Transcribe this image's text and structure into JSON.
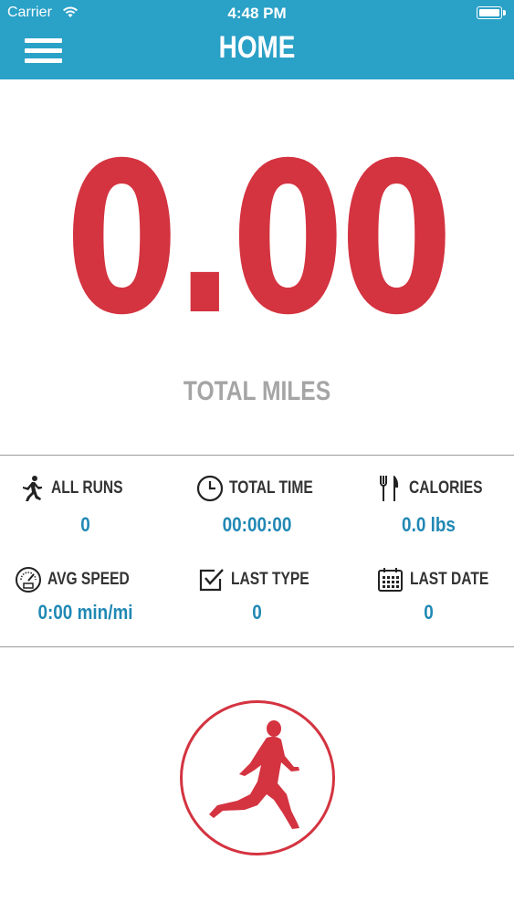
{
  "status_bar": {
    "carrier": "Carrier",
    "time": "4:48 PM"
  },
  "nav": {
    "title": "HOME"
  },
  "summary": {
    "total_value": "0.00",
    "total_label": "TOTAL MILES"
  },
  "stats": [
    {
      "icon": "runner-icon",
      "label": "ALL RUNS",
      "value": "0"
    },
    {
      "icon": "clock-icon",
      "label": "TOTAL TIME",
      "value": "00:00:00"
    },
    {
      "icon": "fork-knife-icon",
      "label": "CALORIES",
      "value": "0.0 lbs"
    },
    {
      "icon": "speedometer-icon",
      "label": "AVG SPEED",
      "value": "0:00 min/mi"
    },
    {
      "icon": "checkbox-icon",
      "label": "LAST TYPE",
      "value": "0"
    },
    {
      "icon": "calendar-icon",
      "label": "LAST DATE",
      "value": "0"
    }
  ],
  "colors": {
    "accent": "#2aa1c7",
    "primary_red": "#d43340",
    "value_blue": "#2088b4",
    "label_gray": "#a5a5a5"
  }
}
